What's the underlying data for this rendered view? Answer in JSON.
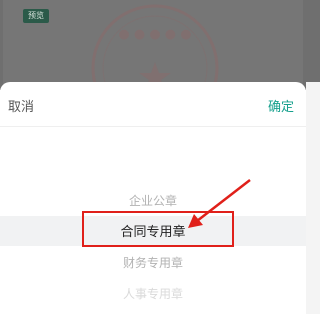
{
  "backdrop": {
    "badge": "预览"
  },
  "sheet": {
    "cancel_label": "取消",
    "confirm_label": "确定",
    "options": [
      "企业公章",
      "合同专用章",
      "财务专用章",
      "人事专用章"
    ],
    "selected": "合同专用章"
  },
  "colors": {
    "confirm": "#16a08d",
    "annotation": "#e0201a",
    "badge_bg": "#2b5a49"
  }
}
